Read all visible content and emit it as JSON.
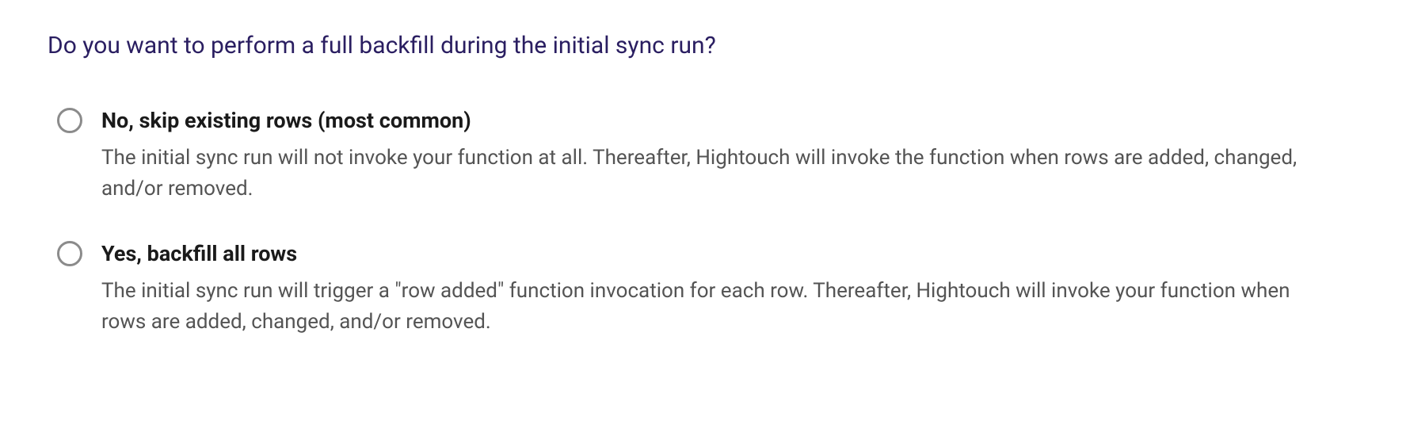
{
  "question": "Do you want to perform a full backfill during the initial sync run?",
  "options": [
    {
      "label": "No, skip existing rows (most common)",
      "description": "The initial sync run will not invoke your function at all. Thereafter, Hightouch will invoke the function when rows are added, changed, and/or removed."
    },
    {
      "label": "Yes, backfill all rows",
      "description": "The initial sync run will trigger a \"row added\" function invocation for each row. Thereafter, Hightouch will invoke your function when rows are added, changed, and/or removed."
    }
  ]
}
